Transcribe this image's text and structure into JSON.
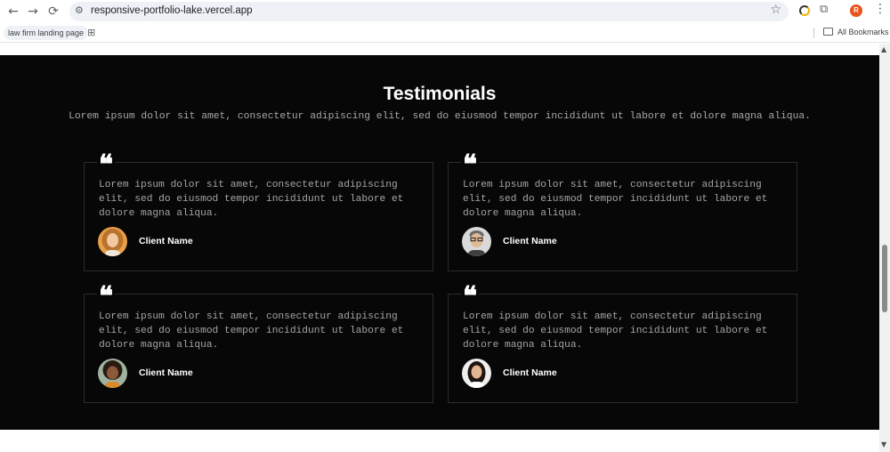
{
  "browser": {
    "nav": {
      "back": "←",
      "forward": "→",
      "reload": "⟳"
    },
    "url": "responsive-portfolio-lake.vercel.app",
    "site_info_icon": "tune-icon",
    "star_icon": "star-outline-icon",
    "profile_initial": "R",
    "profile_color": "#e8541e",
    "menu_icon": "⋮",
    "bookmarks": [
      {
        "label": "law firm landing page"
      }
    ],
    "apps_icon": "⊞",
    "all_bookmarks": "All Bookmarks"
  },
  "testimonials": {
    "title": "Testimonials",
    "subtitle": "Lorem ipsum dolor sit amet, consectetur adipiscing elit, sed do eiusmod tempor incididunt ut labore et dolore magna aliqua.",
    "quote_mark": "❝",
    "cards": [
      {
        "text": "Lorem ipsum dolor sit amet, consectetur adipiscing elit, sed do eiusmod tempor incididunt ut labore et dolore magna aliqua.",
        "name": "Client Name",
        "avatar": "woman-curly-hair-avatar"
      },
      {
        "text": "Lorem ipsum dolor sit amet, consectetur adipiscing elit, sed do eiusmod tempor incididunt ut labore et dolore magna aliqua.",
        "name": "Client Name",
        "avatar": "man-glasses-avatar"
      },
      {
        "text": "Lorem ipsum dolor sit amet, consectetur adipiscing elit, sed do eiusmod tempor incididunt ut labore et dolore magna aliqua.",
        "name": "Client Name",
        "avatar": "woman-afro-avatar"
      },
      {
        "text": "Lorem ipsum dolor sit amet, consectetur adipiscing elit, sed do eiusmod tempor incididunt ut labore et dolore magna aliqua.",
        "name": "Client Name",
        "avatar": "woman-dark-hair-avatar"
      }
    ]
  },
  "colors": {
    "section_bg": "#070707",
    "card_border": "#2b2b2b",
    "body_text": "#a5a5a5",
    "heading": "#ffffff"
  }
}
